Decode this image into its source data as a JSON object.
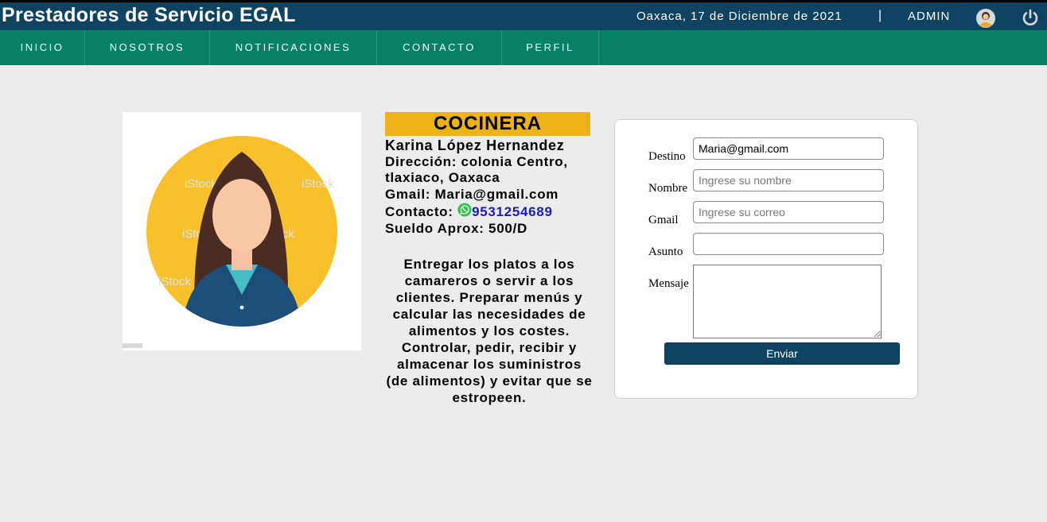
{
  "header": {
    "site_title": "Prestadores de Servicio EGAL",
    "date_text": "Oaxaca, 17 de Diciembre de 2021",
    "separator": "|",
    "user_label": "ADMIN"
  },
  "icons": {
    "user": "user-avatar-icon",
    "logout": "power-icon",
    "contact": "whatsapp-icon"
  },
  "nav": {
    "items": [
      {
        "label": "INICIO"
      },
      {
        "label": "NOSOTROS"
      },
      {
        "label": "NOTIFICACIONES"
      },
      {
        "label": "CONTACTO"
      },
      {
        "label": "PERFIL"
      }
    ]
  },
  "profile": {
    "photo_watermark": "iStock",
    "job_title": "COCINERA",
    "name": "Karina López Hernandez",
    "address": "Dirección: colonia Centro, tlaxiaco, Oaxaca",
    "email": "Gmail: Maria@gmail.com",
    "contact_label": "Contacto:",
    "phone": "9531254689",
    "salary": "Sueldo Aprox: 500/D",
    "description": "Entregar los platos a los camareros o servir a los clientes. Preparar menús y calcular las necesidades de alimentos y los costes. Controlar, pedir, recibir y almacenar los suministros (de alimentos) y evitar que se estropeen."
  },
  "form": {
    "destino_label": "Destino",
    "destino_value": "Maria@gmail.com",
    "nombre_label": "Nombre",
    "nombre_placeholder": "Ingrese su nombre",
    "gmail_label": "Gmail",
    "gmail_placeholder": "Ingrese su correo",
    "asunto_label": "Asunto",
    "asunto_value": "",
    "mensaje_label": "Mensaje",
    "mensaje_value": "",
    "submit_label": "Enviar"
  },
  "colors": {
    "topbar": "#0e4462",
    "navbar": "#068166",
    "job_header": "#edb216",
    "phone_link": "#1a1acb",
    "background": "#ececec"
  }
}
